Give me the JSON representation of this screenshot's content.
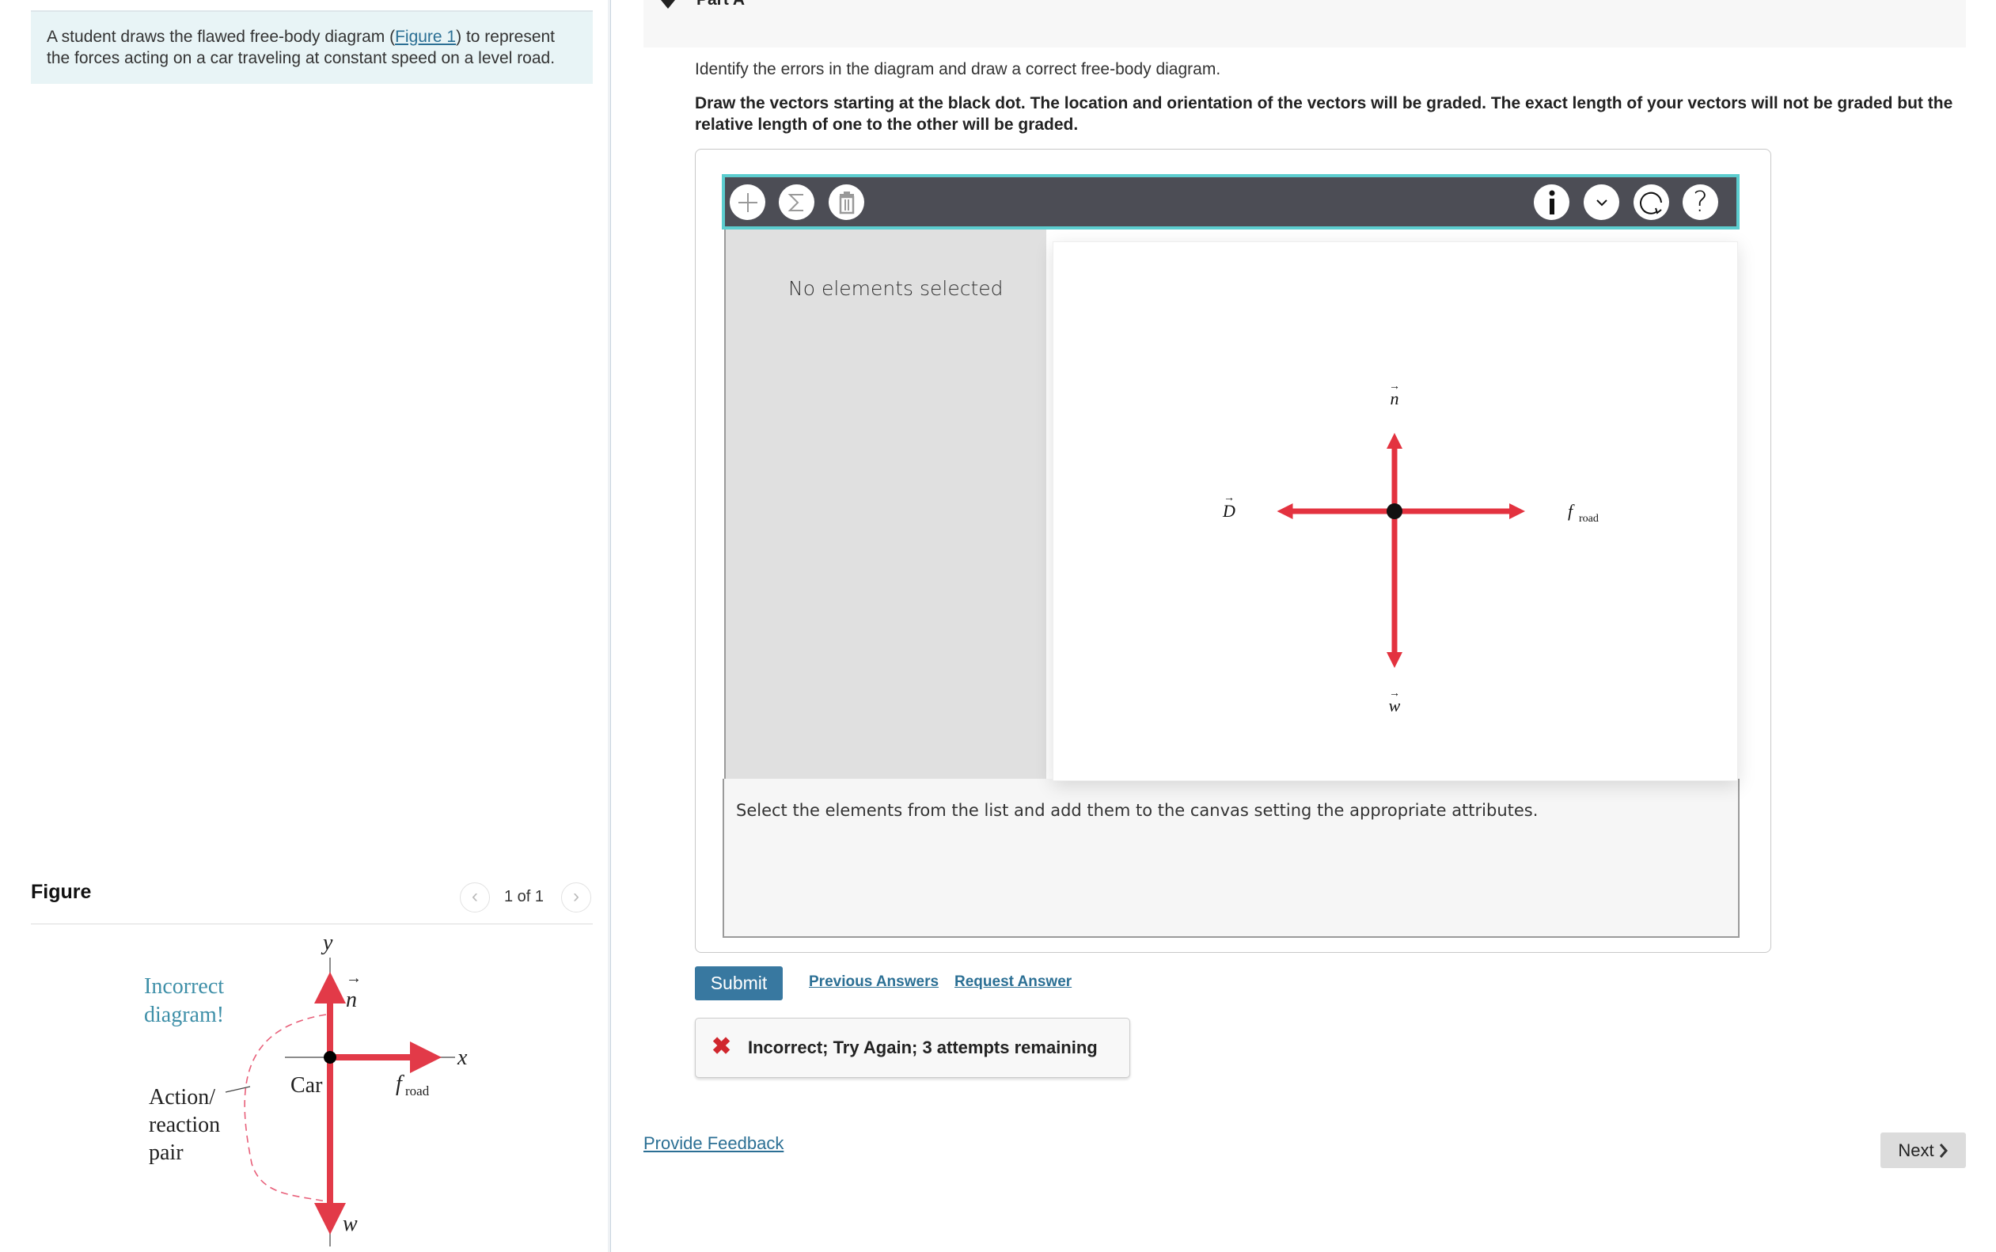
{
  "problem": {
    "text_before": "A student draws the flawed free-body diagram (",
    "figure_link": "Figure 1",
    "text_after": ") to represent the forces acting on a car traveling at constant speed on a level road."
  },
  "figure_panel": {
    "title": "Figure",
    "page_indicator": "1 of 1",
    "prev_icon": "chevron-left-icon",
    "next_icon": "chevron-right-icon",
    "diagram": {
      "caption": [
        "Incorrect",
        "diagram!"
      ],
      "axis_x": "x",
      "axis_y": "y",
      "object_label": "Car",
      "annotation": [
        "Action/",
        "reaction",
        "pair"
      ],
      "vectors": [
        {
          "name": "n",
          "label": "n",
          "direction": "up"
        },
        {
          "name": "f_road",
          "label": "f",
          "subscript": "road",
          "direction": "right"
        },
        {
          "name": "w",
          "label": "w",
          "direction": "down"
        }
      ],
      "colors": {
        "vector": "#e23a48",
        "caption": "#3e8fa8",
        "dashed": "#e8607a"
      }
    }
  },
  "part": {
    "label": "Part A",
    "instruction": "Identify the errors in the diagram and draw a correct free-body diagram.",
    "instruction_bold": "Draw the vectors starting at the black dot. The location and orientation of the vectors will be graded. The exact length of your vectors will not be graded but the relative length of one to the other will be graded."
  },
  "tool": {
    "toolbar_left": [
      {
        "name": "add",
        "icon": "plus-icon"
      },
      {
        "name": "sum",
        "icon": "sigma-icon"
      },
      {
        "name": "delete",
        "icon": "trash-icon"
      }
    ],
    "toolbar_right": [
      {
        "name": "info",
        "icon": "info-icon"
      },
      {
        "name": "more",
        "icon": "chevron-down-icon"
      },
      {
        "name": "reset",
        "icon": "reset-icon"
      },
      {
        "name": "help",
        "icon": "help-icon"
      }
    ],
    "selection_status": "No elements selected",
    "hint": "Select the elements from the list and add them to the canvas setting the appropriate attributes.",
    "canvas_vectors": [
      {
        "name": "n",
        "label": "n",
        "direction": "up",
        "relative_length": 0.6
      },
      {
        "name": "D",
        "label": "D",
        "direction": "left",
        "relative_length": 0.9
      },
      {
        "name": "f_road",
        "label": "f",
        "subscript": "road",
        "direction": "right",
        "relative_length": 1.0
      },
      {
        "name": "w",
        "label": "w",
        "direction": "down",
        "relative_length": 1.2
      }
    ],
    "colors": {
      "vector": "#e3323f",
      "toolbar_bg": "#4c4d55",
      "toolbar_border": "#5ccdcf"
    }
  },
  "actions": {
    "submit": "Submit",
    "previous_answers": "Previous Answers",
    "request_answer": "Request Answer"
  },
  "feedback": {
    "icon": "x-icon",
    "message": "Incorrect; Try Again; 3 attempts remaining"
  },
  "footer": {
    "provide_feedback": "Provide Feedback",
    "next": "Next"
  }
}
